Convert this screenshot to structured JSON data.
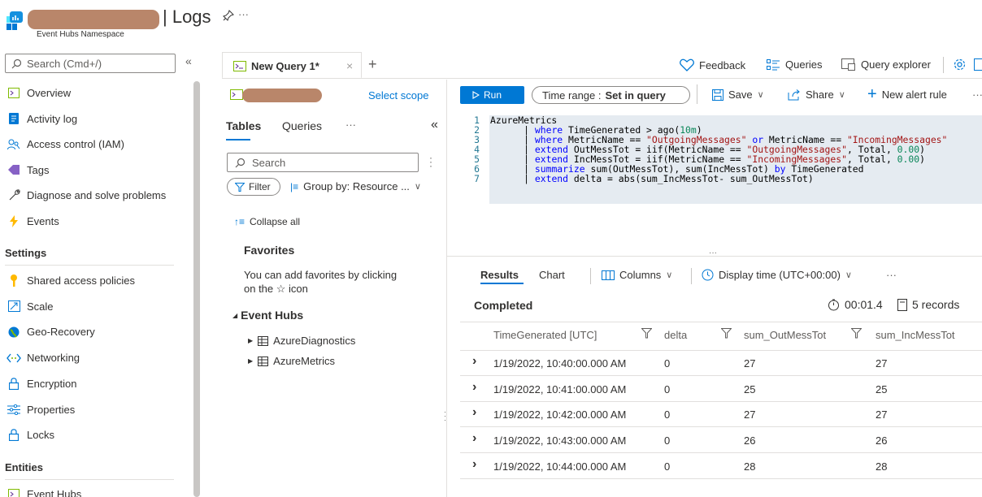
{
  "header": {
    "title": "| Logs",
    "subtitle": "Event Hubs Namespace"
  },
  "sidebar": {
    "search_placeholder": "Search (Cmd+/)",
    "collapse": "«",
    "items": [
      {
        "label": "Overview",
        "icon": "overview-icon"
      },
      {
        "label": "Activity log",
        "icon": "activity-log-icon"
      },
      {
        "label": "Access control (IAM)",
        "icon": "iam-icon"
      },
      {
        "label": "Tags",
        "icon": "tag-icon"
      },
      {
        "label": "Diagnose and solve problems",
        "icon": "wrench-icon"
      },
      {
        "label": "Events",
        "icon": "lightning-icon"
      }
    ],
    "settings_header": "Settings",
    "settings_items": [
      {
        "label": "Shared access policies",
        "icon": "key-icon"
      },
      {
        "label": "Scale",
        "icon": "scale-icon"
      },
      {
        "label": "Geo-Recovery",
        "icon": "globe-icon"
      },
      {
        "label": "Networking",
        "icon": "networking-icon"
      },
      {
        "label": "Encryption",
        "icon": "lock-icon"
      },
      {
        "label": "Properties",
        "icon": "properties-icon"
      },
      {
        "label": "Locks",
        "icon": "lock-icon"
      }
    ],
    "entities_header": "Entities",
    "entities_items": [
      {
        "label": "Event Hubs",
        "icon": "event-hubs-icon"
      }
    ]
  },
  "tabs": {
    "active": "New Query 1*",
    "close": "×",
    "add": "+"
  },
  "topbar": {
    "feedback": "Feedback",
    "queries": "Queries",
    "query_explorer": "Query explorer"
  },
  "toolbar": {
    "select_scope": "Select scope",
    "run": "Run",
    "time_range_label": "Time range :",
    "time_range_value": "Set in query",
    "save": "Save",
    "share": "Share",
    "new_alert": "New alert rule",
    "more": "···"
  },
  "left_panel": {
    "tabs": [
      "Tables",
      "Queries",
      "···"
    ],
    "collapse": "«",
    "search_placeholder": "Search",
    "filter": "Filter",
    "group_by": "Group by: Resource ...",
    "collapse_all": "Collapse all",
    "favorites_header": "Favorites",
    "favorites_text_1": "You can add favorites by clicking",
    "favorites_text_2": "on the ☆ icon",
    "event_hubs_header": "Event Hubs",
    "tables": [
      "AzureDiagnostics",
      "AzureMetrics"
    ]
  },
  "editor": {
    "line_numbers": [
      "1",
      "2",
      "3",
      "4",
      "5",
      "6",
      "7"
    ]
  },
  "results": {
    "tabs": [
      "Results",
      "Chart"
    ],
    "columns_btn": "Columns",
    "display_time": "Display time (UTC+00:00)",
    "more": "···",
    "status": "Completed",
    "elapsed": "00:01.4",
    "records": "5 records",
    "headers": [
      "TimeGenerated [UTC]",
      "delta",
      "sum_OutMessTot",
      "sum_IncMessTot"
    ],
    "rows": [
      [
        "1/19/2022, 10:40:00.000 AM",
        "0",
        "27",
        "27"
      ],
      [
        "1/19/2022, 10:41:00.000 AM",
        "0",
        "25",
        "25"
      ],
      [
        "1/19/2022, 10:42:00.000 AM",
        "0",
        "27",
        "27"
      ],
      [
        "1/19/2022, 10:43:00.000 AM",
        "0",
        "26",
        "26"
      ],
      [
        "1/19/2022, 10:44:00.000 AM",
        "0",
        "28",
        "28"
      ]
    ]
  },
  "colors": {
    "accent": "#0078d4",
    "redaction": "#b9866a"
  }
}
